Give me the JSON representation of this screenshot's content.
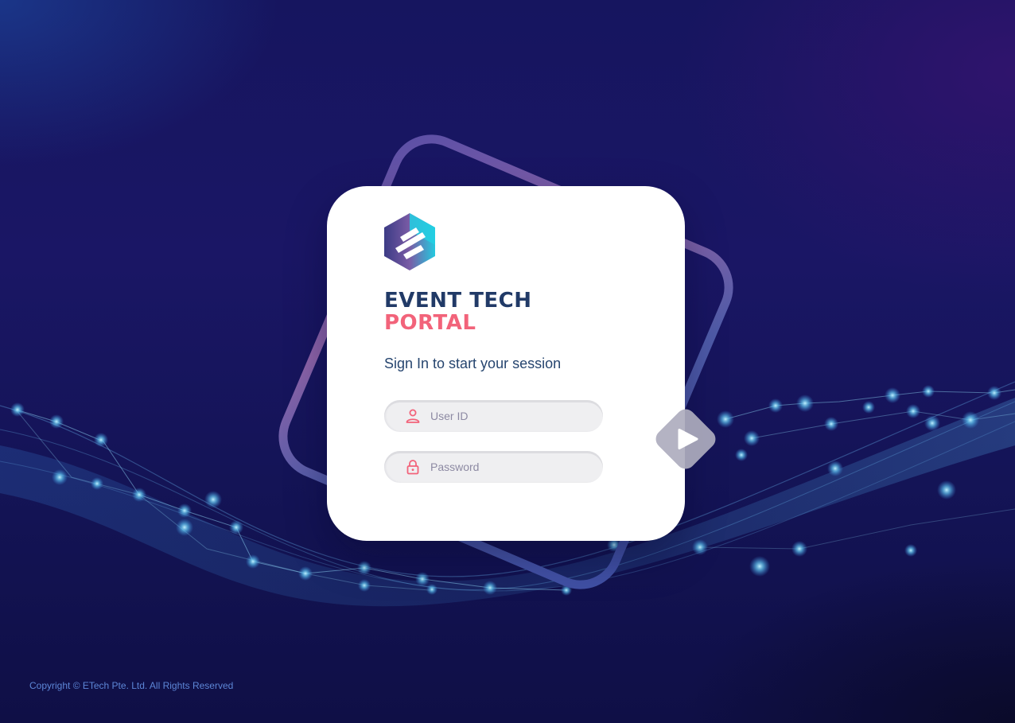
{
  "brand": {
    "logo_icon": "event-tech-hexagon-logo",
    "title_line1": "EVENT TECH",
    "title_line2": "PORTAL"
  },
  "login": {
    "subtitle": "Sign In to start your session",
    "user_id": {
      "icon": "user-icon",
      "placeholder": "User ID",
      "value": ""
    },
    "password": {
      "icon": "lock-icon",
      "placeholder": "Password",
      "value": ""
    },
    "submit_icon": "play-arrow-icon"
  },
  "footer": {
    "copyright": "Copyright © ETech Pte. Ltd. All Rights Reserved"
  },
  "colors": {
    "background": "#16155f",
    "title_primary": "#213a67",
    "title_accent": "#f2637a",
    "icon_accent": "#f2637a",
    "field_bg": "#efeff1",
    "submit_bg": "#aeadbe",
    "footer_text": "#5d86d6"
  }
}
